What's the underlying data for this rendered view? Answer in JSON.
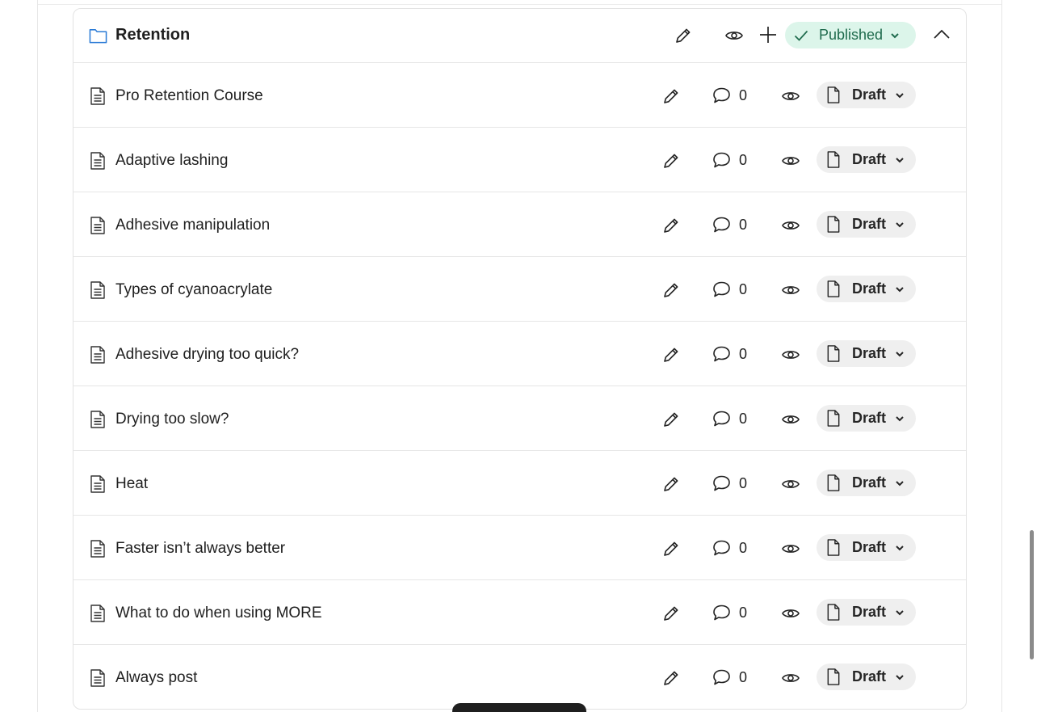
{
  "section": {
    "title": "Retention",
    "status_label": "Published",
    "icon": "folder-icon"
  },
  "lessons": [
    {
      "title": "Pro Retention Course",
      "comments": "0",
      "status": "Draft"
    },
    {
      "title": "Adaptive lashing",
      "comments": "0",
      "status": "Draft"
    },
    {
      "title": "Adhesive manipulation",
      "comments": "0",
      "status": "Draft"
    },
    {
      "title": "Types of cyanoacrylate",
      "comments": "0",
      "status": "Draft"
    },
    {
      "title": "Adhesive drying too quick?",
      "comments": "0",
      "status": "Draft"
    },
    {
      "title": "Drying too slow?",
      "comments": "0",
      "status": "Draft"
    },
    {
      "title": "Heat",
      "comments": "0",
      "status": "Draft"
    },
    {
      "title": "Faster isn’t always better",
      "comments": "0",
      "status": "Draft"
    },
    {
      "title": "What to do when using MORE",
      "comments": "0",
      "status": "Draft"
    },
    {
      "title": "Always post",
      "comments": "0",
      "status": "Draft"
    }
  ],
  "colors": {
    "published_bg": "#dcf5ea",
    "published_text": "#1f6b4d",
    "draft_bg": "#efefef",
    "folder_icon": "#2b7bd6"
  }
}
